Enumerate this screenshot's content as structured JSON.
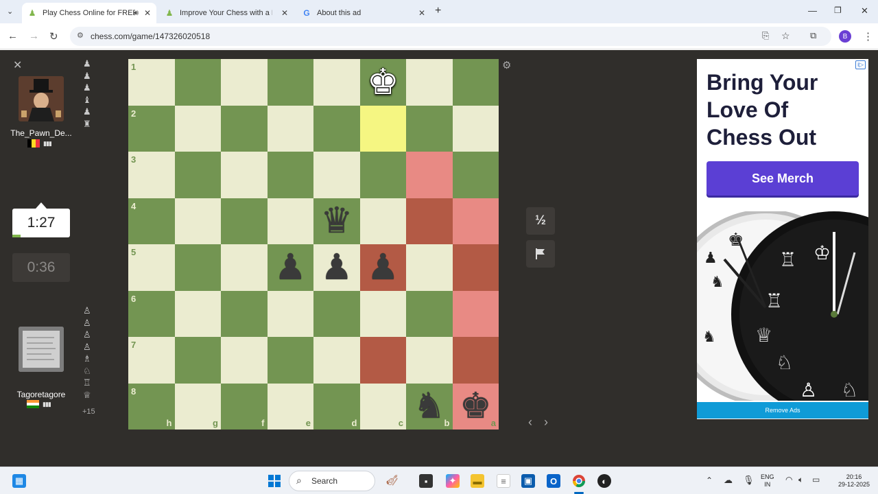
{
  "browser": {
    "tabs": [
      {
        "title": "Play Chess Online for FREE",
        "active": true,
        "favicon": "chess-pawn-icon",
        "audio": true
      },
      {
        "title": "Improve Your Chess with a Pren",
        "active": false,
        "favicon": "chess-pawn-icon"
      },
      {
        "title": "About this ad",
        "active": false,
        "favicon": "google-icon"
      }
    ],
    "url": "chess.com/game/147326020518",
    "profile_initial": "B"
  },
  "game": {
    "top_player": {
      "name": "The_Pawn_De...",
      "clock": "0:36",
      "flag_colors": [
        "#000000",
        "#fdda24",
        "#ef3340"
      ]
    },
    "bottom_player": {
      "name": "Tagoretagore",
      "clock": "1:27",
      "material_advantage": "+15"
    },
    "draw_label": "½",
    "board": {
      "ranks": [
        "1",
        "2",
        "3",
        "4",
        "5",
        "6",
        "7",
        "8"
      ],
      "files": [
        "h",
        "g",
        "f",
        "e",
        "d",
        "c",
        "b",
        "a"
      ],
      "pieces": [
        {
          "glyph": "♚",
          "color": "white",
          "row": 0,
          "col": 5,
          "name": "white-king"
        },
        {
          "glyph": "♛",
          "color": "black",
          "row": 3,
          "col": 4,
          "name": "black-queen"
        },
        {
          "glyph": "♟",
          "color": "black",
          "row": 4,
          "col": 3,
          "name": "black-pawn"
        },
        {
          "glyph": "♟",
          "color": "black",
          "row": 4,
          "col": 4,
          "name": "black-pawn"
        },
        {
          "glyph": "♟",
          "color": "black",
          "row": 4,
          "col": 5,
          "name": "black-pawn"
        },
        {
          "glyph": "♞",
          "color": "black",
          "row": 7,
          "col": 6,
          "name": "black-knight"
        },
        {
          "glyph": "♚",
          "color": "black",
          "row": 7,
          "col": 7,
          "name": "black-king"
        }
      ],
      "highlights": [
        {
          "row": 1,
          "col": 5,
          "color": "#f5f682"
        },
        {
          "row": 2,
          "col": 6,
          "color": "#e88a84"
        },
        {
          "row": 3,
          "col": 6,
          "color": "#b35a45"
        },
        {
          "row": 3,
          "col": 7,
          "color": "#e88a84"
        },
        {
          "row": 4,
          "col": 5,
          "color": "#b35a45"
        },
        {
          "row": 4,
          "col": 7,
          "color": "#b35a45"
        },
        {
          "row": 5,
          "col": 7,
          "color": "#e88a84"
        },
        {
          "row": 6,
          "col": 5,
          "color": "#b35a45"
        },
        {
          "row": 6,
          "col": 7,
          "color": "#b35a45"
        },
        {
          "row": 7,
          "col": 7,
          "color": "#e88a84"
        }
      ],
      "light_color": "#ebecd0",
      "dark_color": "#739552"
    },
    "top_captured": [
      "♟",
      "♟",
      "♟",
      "♝",
      "♟",
      "♜"
    ],
    "bottom_captured": [
      "♙",
      "♙",
      "♙",
      "♙",
      "♗",
      "♘",
      "♖",
      "♕"
    ]
  },
  "ad": {
    "headline": "Bring Your Love Of Chess Out",
    "button": "See Merch",
    "remove": "Remove Ads",
    "info_badge": "i▷"
  },
  "taskbar": {
    "search_placeholder": "Search",
    "lang_top": "ENG",
    "lang_bottom": "IN",
    "time": "20:16",
    "date": "29-12-2025"
  }
}
